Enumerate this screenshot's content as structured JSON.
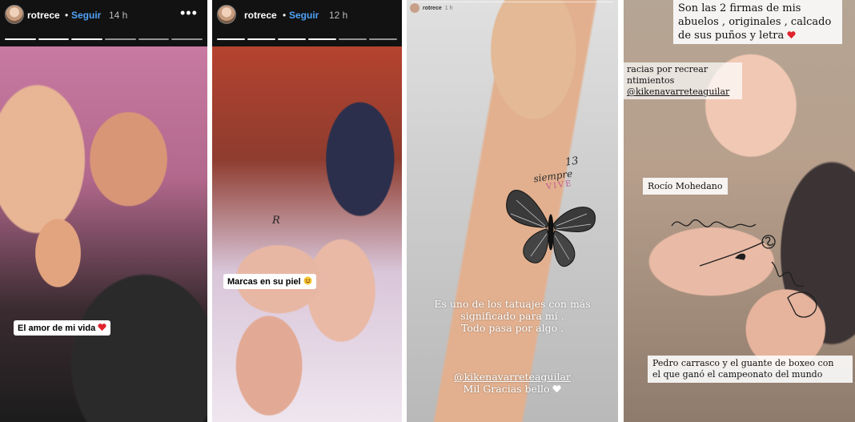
{
  "stories": [
    {
      "username": "rotrece",
      "follow": "Seguir",
      "time": "14 h",
      "more": "•••",
      "sticker": "El amor de mi vida"
    },
    {
      "username": "rotrece",
      "follow": "Seguir",
      "time": "12 h",
      "sticker": "Marcas en su piel",
      "tattoo_text": "R"
    },
    {
      "username": "rotrece",
      "time": "1 h",
      "caption_lines": [
        "Es uno de los tatuajes con más",
        "significado para mí .",
        "Todo pasa por algo ."
      ],
      "mention": "@kikenavarreteaguilar",
      "thanks": "Mil Gracias bello",
      "tattoo": {
        "number": "13",
        "line1": "siempre",
        "line2": "VIVE"
      }
    },
    {
      "header_lines": [
        "Son las 2 firmas de mis",
        "abuelos , originales , calcado",
        "de sus puños y letra"
      ],
      "repost_lines": [
        "racias por recrear",
        "ntimientos"
      ],
      "repost_mention": "@kikenavarreteaguilar",
      "label_rocio": "Rocío Mohedano",
      "footer_lines": [
        "Pedro carrasco y el guante de boxeo con",
        "el que ganó el campeonato del mundo"
      ]
    }
  ],
  "colors": {
    "follow": "#4fa3f7",
    "heart": "#e0242d",
    "header_bg": "#121212"
  },
  "icons": [
    "heart-icon",
    "smile-emoji-icon",
    "white-heart-icon",
    "more-options-icon"
  ]
}
